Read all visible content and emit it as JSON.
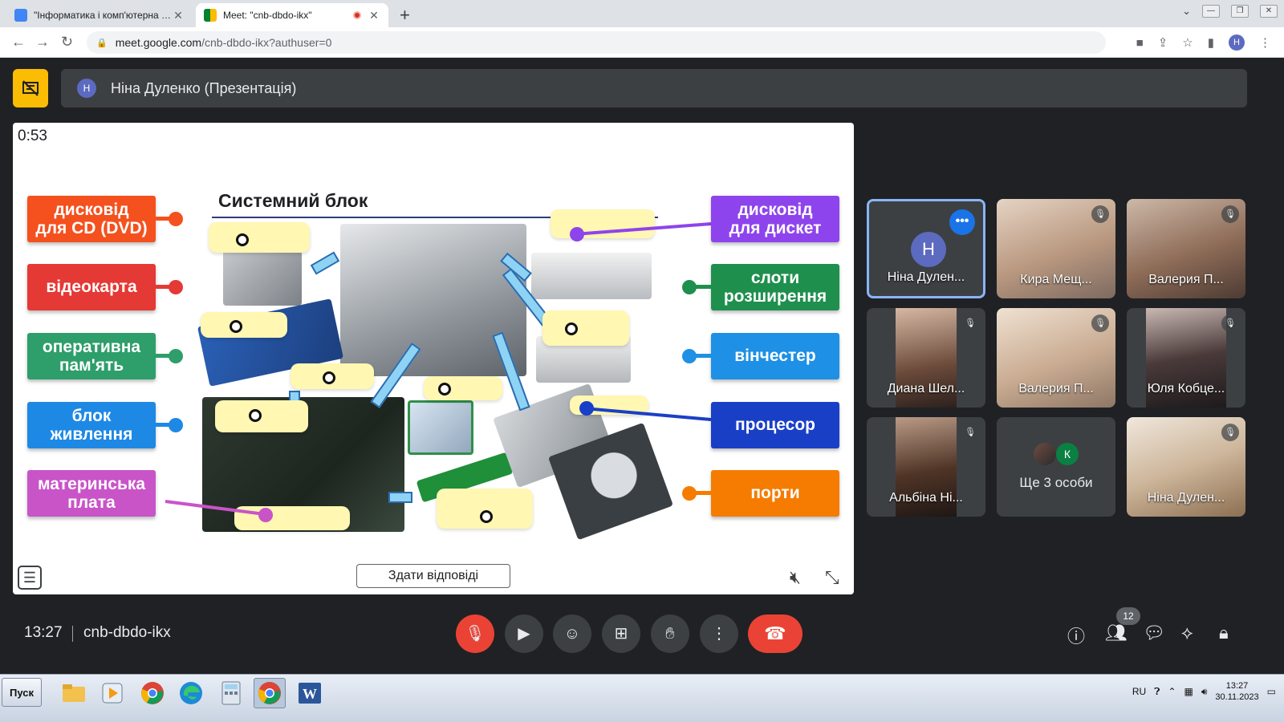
{
  "browser": {
    "tabs": [
      {
        "title": "\"Інформатика і комп'ютерна техні",
        "active": false
      },
      {
        "title": "Meet: \"cnb-dbdo-ikx\"",
        "active": true,
        "recording": true
      }
    ],
    "url_domain": "meet.google.com",
    "url_path": "/cnb-dbdo-ikx?authuser=0",
    "profile_initial": "H"
  },
  "presenter": {
    "initial": "Н",
    "label": "Ніна Дуленко (Презентація)"
  },
  "slide": {
    "timer": "0:53",
    "title": "Системний блок",
    "labels_left": [
      {
        "text": "дисковід\nдля CD (DVD)",
        "color": "#f4511e"
      },
      {
        "text": "відеокарта",
        "color": "#e53935"
      },
      {
        "text": "оперативна\nпам'ять",
        "color": "#2e9e6b"
      },
      {
        "text": "блок\nживлення",
        "color": "#1e88e5"
      },
      {
        "text": "материнська\nплата",
        "color": "#c954c8"
      }
    ],
    "labels_right": [
      {
        "text": "дисковід\nдля дискет",
        "color": "#8e44ec"
      },
      {
        "text": "слоти\nрозширення",
        "color": "#1f8f4e"
      },
      {
        "text": "вінчестер",
        "color": "#1e90e5"
      },
      {
        "text": "процесор",
        "color": "#1a3fc7"
      },
      {
        "text": "порти",
        "color": "#f57c00"
      }
    ],
    "submit_label": "Здати відповіді"
  },
  "participants": [
    {
      "name": "Ніна Дулен...",
      "initial": "Н",
      "self": true
    },
    {
      "name": "Кира Мещ..."
    },
    {
      "name": "Валерия П..."
    },
    {
      "name": "Диана Шел..."
    },
    {
      "name": "Валерия П..."
    },
    {
      "name": "Юля Кобце..."
    },
    {
      "name": "Альбіна Ні..."
    },
    {
      "name": "Ще 3 особи",
      "mini_initial": "К"
    },
    {
      "name": "Ніна Дулен..."
    }
  ],
  "meeting": {
    "time": "13:27",
    "code": "cnb-dbdo-ikx",
    "people_count": "12"
  },
  "taskbar": {
    "start_label": "Пуск",
    "lang": "RU",
    "time": "13:27",
    "date": "30.11.2023"
  }
}
